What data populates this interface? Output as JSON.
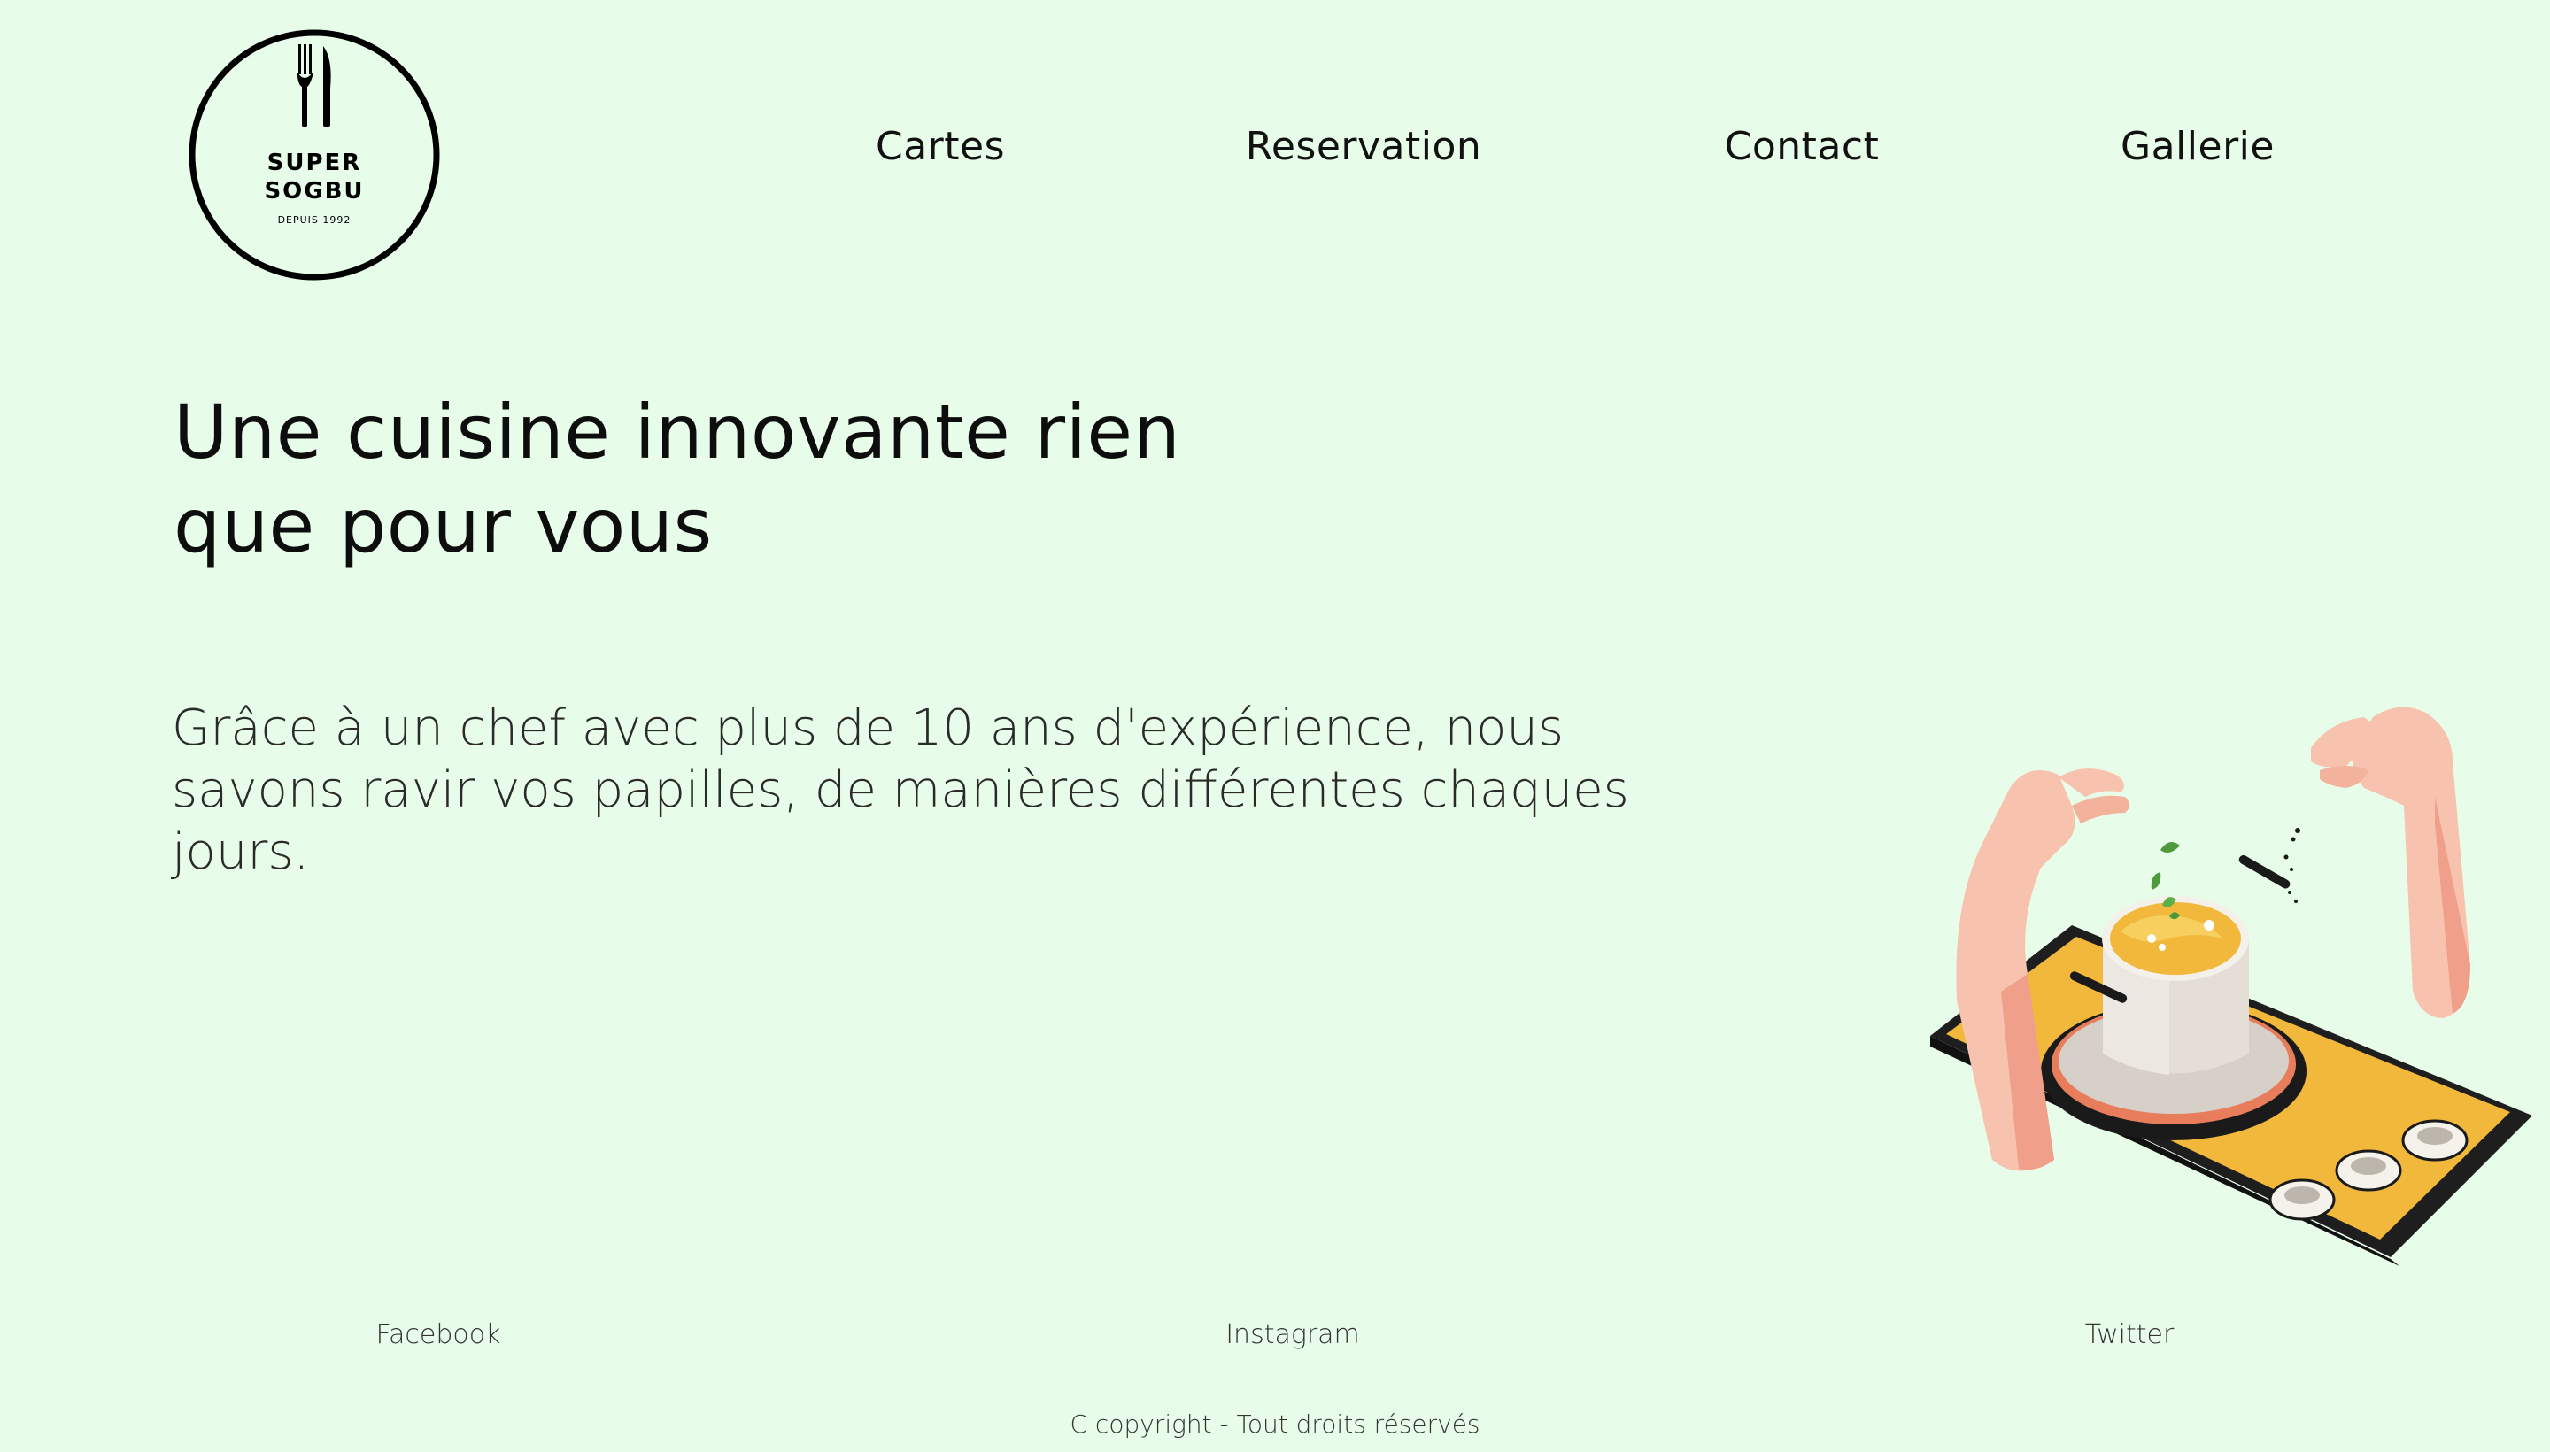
{
  "brand": {
    "line1": "SUPER",
    "line2": "SOGBU",
    "tagline": "DEPUIS 1992",
    "icon": "fork-knife-icon"
  },
  "nav": {
    "items": [
      {
        "label": "Cartes"
      },
      {
        "label": "Reservation"
      },
      {
        "label": "Contact"
      },
      {
        "label": "Gallerie"
      }
    ]
  },
  "hero": {
    "title_line1": "Une cuisine innovante rien",
    "title_line2": "que pour vous",
    "description": "Grâce à un chef avec plus de 10 ans d'expérience, nous savons ravir vos papilles, de manières différentes chaques jours.",
    "illustration": "hands-cooking-pot-on-stove-illustration"
  },
  "footer": {
    "social": [
      {
        "label": "Facebook"
      },
      {
        "label": "Instagram"
      },
      {
        "label": "Twitter"
      }
    ],
    "copyright": "C copyright - Tout droits réservés"
  },
  "colors": {
    "background": "#e8fde9",
    "text": "#111111",
    "accent_yellow": "#f2b83b",
    "skin": "#f7c3ae"
  }
}
